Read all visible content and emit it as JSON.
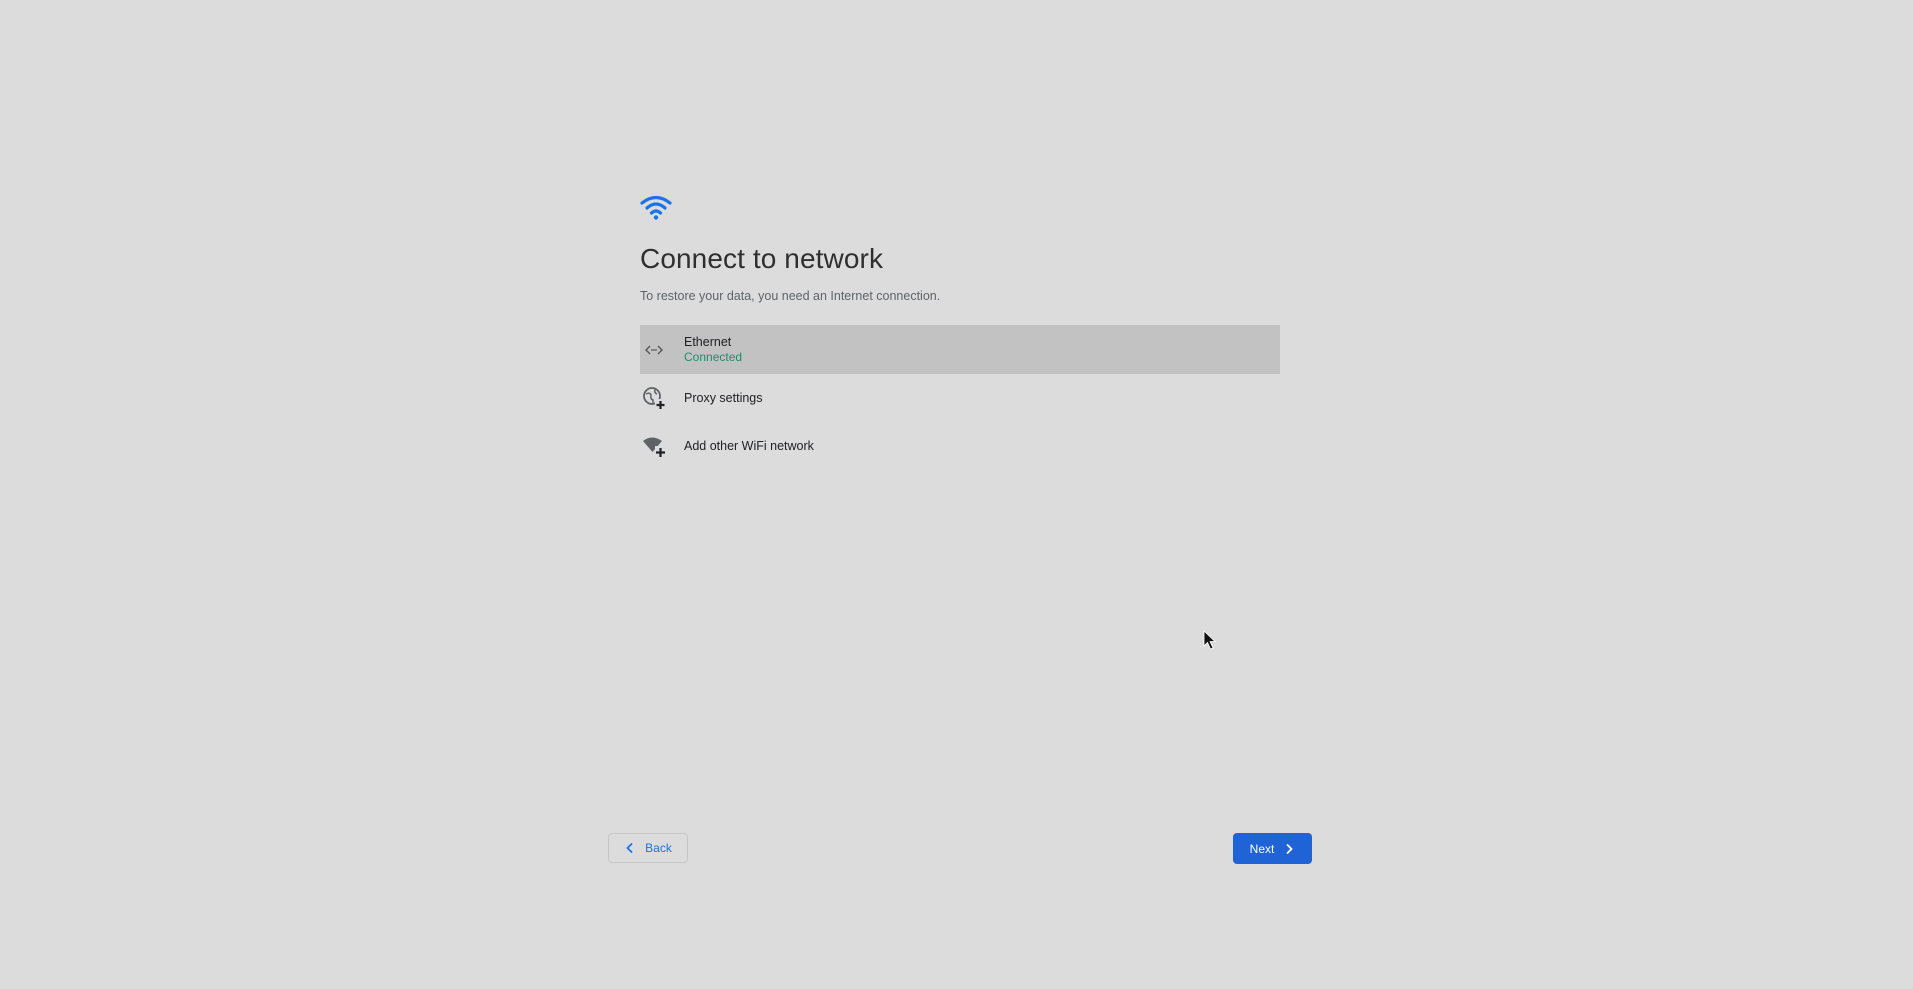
{
  "header": {
    "icon": "wifi-icon",
    "title": "Connect to network",
    "subtitle": "To restore your data, you need an Internet connection."
  },
  "networks": [
    {
      "icon": "ethernet-icon",
      "name": "Ethernet",
      "status": "Connected",
      "selected": true
    },
    {
      "icon": "proxy-settings-icon",
      "name": "Proxy settings"
    },
    {
      "icon": "add-wifi-icon",
      "name": "Add other WiFi network"
    }
  ],
  "footer": {
    "back_label": "Back",
    "next_label": "Next"
  },
  "colors": {
    "background": "#dcdcdc",
    "accent": "#1a73e8",
    "primary_button": "#1f63d6",
    "connected_status": "#1e8e6e",
    "selected_row": "#c2c2c2"
  }
}
